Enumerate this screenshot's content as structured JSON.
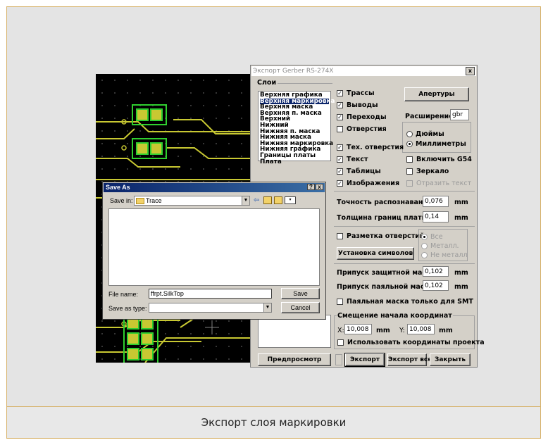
{
  "caption": "Экспорт слоя маркировки",
  "gerber_dialog": {
    "title": "Экспорт Gerber RS-274X",
    "close_label": "x",
    "layers_group_label": "Слои",
    "layers": [
      {
        "label": "Верхняя графика",
        "selected": false
      },
      {
        "label": "Верхняя маркировка",
        "selected": true
      },
      {
        "label": "Верхняя маска",
        "selected": false
      },
      {
        "label": "Верхняя п. маска",
        "selected": false
      },
      {
        "label": "Верхний",
        "selected": false
      },
      {
        "label": "Нижний",
        "selected": false
      },
      {
        "label": "Нижняя п. маска",
        "selected": false
      },
      {
        "label": "Нижняя маска",
        "selected": false
      },
      {
        "label": "Нижняя маркировка",
        "selected": false
      },
      {
        "label": "Нижняя графика",
        "selected": false
      },
      {
        "label": "Границы платы",
        "selected": false
      },
      {
        "label": "Плата",
        "selected": false
      }
    ],
    "checkboxes": [
      {
        "label": "Трассы",
        "checked": true
      },
      {
        "label": "Выводы",
        "checked": true
      },
      {
        "label": "Переходы",
        "checked": true
      },
      {
        "label": "Отверстия",
        "checked": false
      },
      {
        "label": "Тех. отверстия",
        "checked": true
      },
      {
        "label": "Текст",
        "checked": true
      },
      {
        "label": "Таблицы",
        "checked": true
      },
      {
        "label": "Изображения",
        "checked": true
      }
    ],
    "apertures_button": "Апертуры",
    "extension_label": "Расширение:",
    "extension_value": "gbr",
    "units": [
      {
        "label": "Дюймы",
        "selected": false
      },
      {
        "label": "Миллиметры",
        "selected": true
      }
    ],
    "right_checkboxes": [
      {
        "label": "Включить G54",
        "checked": false,
        "disabled": false
      },
      {
        "label": "Зеркало",
        "checked": false,
        "disabled": false
      },
      {
        "label": "Отразить текст",
        "checked": false,
        "disabled": true
      }
    ],
    "precision_label": "Точность распознавания:",
    "precision_value": "0,076",
    "border_thickness_label": "Толщина границ платы:",
    "border_thickness_value": "0,14",
    "unit_mm": "mm",
    "hole_marking_label": "Разметка отверстий",
    "symbol_setup_button": "Установка символов",
    "hole_options": [
      {
        "label": "Все",
        "selected": true
      },
      {
        "label": "Металл.",
        "selected": false
      },
      {
        "label": "Не металл",
        "selected": false
      }
    ],
    "solder_mask_label": "Припуск защитной маски:",
    "solder_mask_value": "0,102",
    "paste_mask_label": "Припуск паяльной маски:",
    "paste_mask_value": "0,102",
    "smt_only_label": "Паяльная маска только для SMT",
    "offset_group_label": "Смещение начала координат",
    "x_label": "X:",
    "x_value": "10,008",
    "y_label": "Y:",
    "y_value": "10,008",
    "use_project_coords_label": "Использовать координаты проекта",
    "preview_button": "Предпросмотр",
    "export_button": "Экспорт",
    "export_all_button": "Экспорт все",
    "close_button": "Закрыть"
  },
  "save_as_dialog": {
    "title": "Save As",
    "help_label": "?",
    "close_label": "x",
    "save_in_label": "Save in:",
    "save_in_value": "Trace",
    "file_name_label": "File name:",
    "file_name_value": "ffrpt.SilkTop",
    "save_as_type_label": "Save as type:",
    "save_as_type_value": "",
    "save_button": "Save",
    "cancel_button": "Cancel"
  },
  "colors": {
    "pcb_background": "#000000",
    "trace": "#c8c832",
    "pad_outline": "#2fcf2f",
    "selection": "#0a246a",
    "frame_border": "#d7b26a"
  }
}
